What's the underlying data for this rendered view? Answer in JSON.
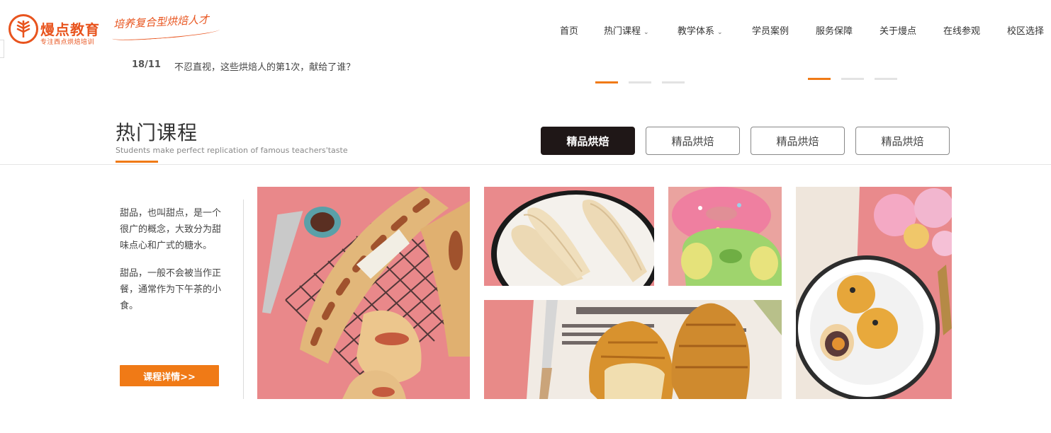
{
  "header": {
    "logo_name": "熳点教育",
    "logo_sub": "专注西点烘焙培训",
    "slogan": "培养复合型烘焙人才",
    "brand_color": "#e8541e",
    "nav": [
      {
        "label": "首页",
        "dropdown": false
      },
      {
        "label": "热门课程",
        "dropdown": true
      },
      {
        "label": "教学体系",
        "dropdown": true
      },
      {
        "label": "学员案例",
        "dropdown": false
      },
      {
        "label": "服务保障",
        "dropdown": false
      },
      {
        "label": "关于熳点",
        "dropdown": false
      },
      {
        "label": "在线参观",
        "dropdown": false
      },
      {
        "label": "校区选择",
        "dropdown": false
      }
    ]
  },
  "news": {
    "date": "18/11",
    "title": "不忍直视，这些烘焙人的第1次，献给了谁？"
  },
  "sliders": {
    "left_active": 1,
    "right_active": 1,
    "accent_color": "#f07a16"
  },
  "section": {
    "title": "热门课程",
    "subtitle": "Students make perfect replication of famous teachers'taste",
    "tabs": [
      "精品烘焙",
      "精品烘焙",
      "精品烘焙",
      "精品烘焙"
    ],
    "active_tab": 0
  },
  "course": {
    "desc_1": "甜品，也叫甜点，是一个很广的概念，大致分为甜味点心和广式的糖水。",
    "desc_2": "甜品，一般不会被当作正餐，通常作为下午茶的小食。",
    "detail_button": "课程详情>>",
    "photos": [
      "baguette-sausage-photo",
      "bread-rolls-photo",
      "donut-photo",
      "croissant-photo",
      "mooncake-photo"
    ]
  }
}
